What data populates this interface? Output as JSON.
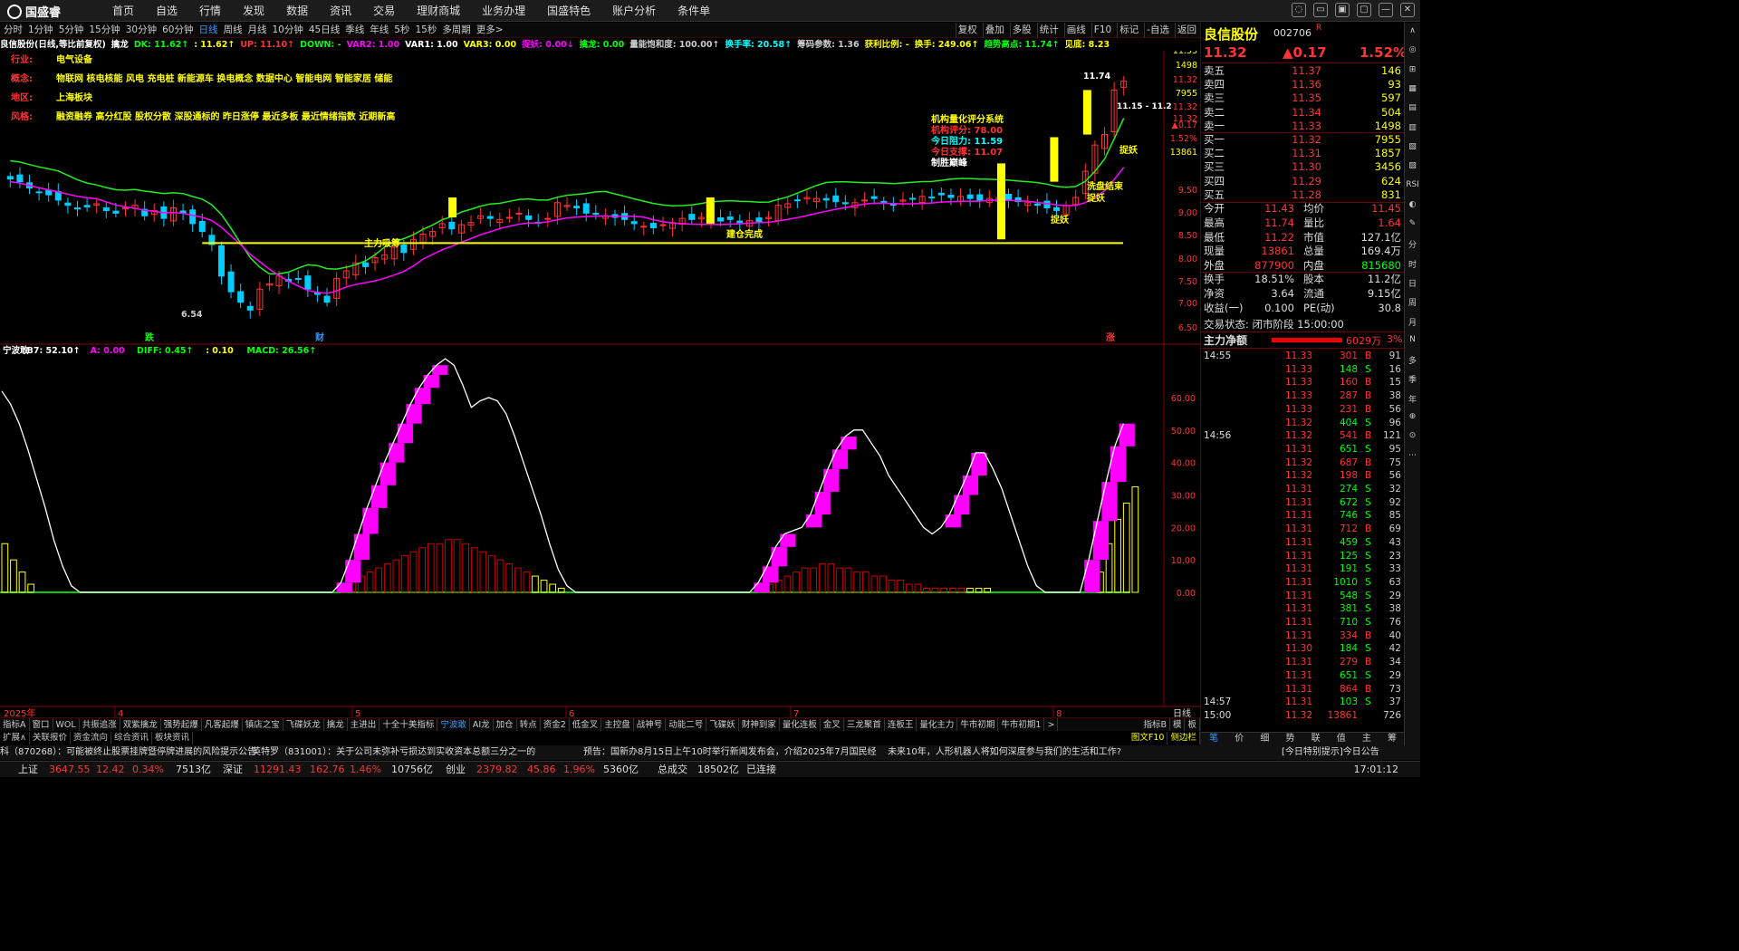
{
  "brand": {
    "name": "国盛睿"
  },
  "menu": [
    "首页",
    "自选",
    "行情",
    "发现",
    "数据",
    "资讯",
    "交易",
    "理财商城",
    "业务办理",
    "国盛特色",
    "账户分析",
    "条件单"
  ],
  "window_buttons": [
    "◌",
    "▭",
    "▣",
    "▢",
    "—",
    "✕"
  ],
  "periods": [
    "分时",
    "1分钟",
    "5分钟",
    "15分钟",
    "30分钟",
    "60分钟",
    "日线",
    "周线",
    "月线",
    "10分钟",
    "45日线",
    "季线",
    "年线",
    "5秒",
    "15秒",
    "多周期",
    "更多>"
  ],
  "active_period": "日线",
  "tools_right": [
    "复权",
    "叠加",
    "多股",
    "统计",
    "画线",
    "F10",
    "标记",
    "-自选",
    "返回"
  ],
  "indicator_line": [
    {
      "t": "良信股份(日线,等比前复权)",
      "c": "#fff"
    },
    {
      "t": "擒龙",
      "c": "#fff"
    },
    {
      "t": "DK: 11.62↑",
      "c": "#0f0"
    },
    {
      "t": ": 11.62↑",
      "c": "#ff0"
    },
    {
      "t": "UP: 11.10↑",
      "c": "#f33"
    },
    {
      "t": "DOWN: -",
      "c": "#0f0"
    },
    {
      "t": "VAR2: 1.00",
      "c": "#f0f"
    },
    {
      "t": "VAR1: 1.00",
      "c": "#fff"
    },
    {
      "t": "VAR3: 0.00",
      "c": "#ff0"
    },
    {
      "t": "捉妖: 0.00↓",
      "c": "#f0f"
    },
    {
      "t": "擒龙: 0.00",
      "c": "#0f0"
    },
    {
      "t": "量能饱和度: 100.00↑",
      "c": "#ccc"
    },
    {
      "t": "换手率: 20.58↑",
      "c": "#0ff"
    },
    {
      "t": "筹码参数: 1.36",
      "c": "#ccc"
    },
    {
      "t": "获利比例: -",
      "c": "#ff0"
    },
    {
      "t": "换手: 249.06↑",
      "c": "#ff0"
    },
    {
      "t": "趋势高点: 11.74↑",
      "c": "#0f0"
    },
    {
      "t": "见底: 8.23",
      "c": "#ff0"
    }
  ],
  "info": [
    {
      "k": "行业:",
      "v": "电气设备"
    },
    {
      "k": "概念:",
      "v": "物联网 核电核能 风电 充电桩 新能源车 换电概念 数据中心 智能电网 智能家居 储能"
    },
    {
      "k": "地区:",
      "v": "上海板块"
    },
    {
      "k": "风格:",
      "v": "融资融券 高分红股 股权分散 深股通标的 昨日涨停 最近多板 最近情绪指数 近期新高"
    }
  ],
  "quant": {
    "title": "机构量化评分系统",
    "score_label": "机构评分:",
    "score": "78.00",
    "res_label": "今日阻力:",
    "res": "11.59",
    "sup_label": "今日支撑:",
    "sup": "11.07",
    "tag": "制胜巅峰"
  },
  "annotations": {
    "zlxc": "主力吸筹",
    "jcwc": "建仓完成",
    "xpjs": "洗盘结束",
    "zy": "捉妖",
    "low": "6.54",
    "high": "11.74",
    "range": "11.15 - 11.2",
    "die": "跌",
    "cai": "财",
    "zhang": "涨"
  },
  "price_axis": [
    "11.33",
    "1498",
    "11.32",
    "7955",
    "11.32",
    "11.32",
    "▲0.17",
    "1.52%",
    "13861",
    "9.50",
    "9.00",
    "8.50",
    "8.00",
    "7.50",
    "7.00",
    "6.50"
  ],
  "macd_line": [
    {
      "t": "宁波敢",
      "c": "#fff"
    },
    {
      "t": "B7: 52.10↑",
      "c": "#fff"
    },
    {
      "t": "A: 0.00",
      "c": "#f0f"
    },
    {
      "t": "DIFF: 0.45↑",
      "c": "#0f0"
    },
    {
      "t": ": 0.10",
      "c": "#ff0"
    },
    {
      "t": "MACD: 26.56↑",
      "c": "#0f0"
    }
  ],
  "sub_axis": [
    "60.00",
    "50.00",
    "40.00",
    "30.00",
    "20.00",
    "10.00",
    "0.00"
  ],
  "dates": [
    "2025年",
    "4",
    "5",
    "6",
    "7",
    "8"
  ],
  "day_label": "日线",
  "bottom_tabs": [
    "指标A",
    "窗口",
    "WOL",
    "共振追涨",
    "双紫擒龙",
    "强势起爆",
    "凡客起爆",
    "镇店之宝",
    "飞碟妖龙",
    "擒龙",
    "主进出",
    "十全十美指标",
    "宁波敢",
    "AI龙",
    "加仓",
    "转点",
    "资金2",
    "低金叉",
    "主控盘",
    "战神号",
    "动能二号",
    "飞碟妖",
    "财神到家",
    "量化连板",
    "金叉",
    "三龙聚首",
    "连板王",
    "量化主力",
    "牛市初期",
    "牛市初期1",
    ">"
  ],
  "active_tab": "宁波敢",
  "bottom_tabs_right": [
    "指标B",
    "模",
    "板"
  ],
  "tabs2": [
    "扩展∧",
    "关联报价",
    "资金流向",
    "综合资讯",
    "板块资讯"
  ],
  "tabs2_right": [
    "图文F10",
    "侧边栏"
  ],
  "news": [
    "科（870268）：可能被终止股票挂牌暨停牌进展的风险提示公告",
    "英特罗（831001）：关于公司未弥补亏损达到实收资本总额三分之一的",
    "预告：国新办8月15日上午10时举行新闻发布会，介绍2025年7月国民经",
    "未来10年，人形机器人将如何深度参与我们的生活和工作?",
    "[今日特别提示]今日公告"
  ],
  "status": [
    {
      "t": "上证",
      "c": "#ddd"
    },
    {
      "t": "3647.55",
      "c": "#f33"
    },
    {
      "t": "12.42",
      "c": "#f33"
    },
    {
      "t": "0.34%",
      "c": "#f33"
    },
    {
      "t": "7513亿",
      "c": "#ddd"
    },
    {
      "t": "深证",
      "c": "#ddd"
    },
    {
      "t": "11291.43",
      "c": "#f33"
    },
    {
      "t": "162.76",
      "c": "#f33"
    },
    {
      "t": "1.46%",
      "c": "#f33"
    },
    {
      "t": "10756亿",
      "c": "#ddd"
    },
    {
      "t": "创业",
      "c": "#ddd"
    },
    {
      "t": "2379.82",
      "c": "#f33"
    },
    {
      "t": "45.86",
      "c": "#f33"
    },
    {
      "t": "1.96%",
      "c": "#f33"
    },
    {
      "t": "5360亿",
      "c": "#ddd"
    },
    {
      "t": "总成交",
      "c": "#ddd"
    },
    {
      "t": "18502亿",
      "c": "#ddd"
    },
    {
      "t": "已连接",
      "c": "#ddd"
    }
  ],
  "clock": "17:01:12",
  "quote": {
    "name": "良信股份",
    "code": "002706",
    "mark": "R",
    "price": "11.32",
    "chg": "▲0.17",
    "pct": "1.52%"
  },
  "asks": [
    {
      "l": "卖五",
      "p": "11.37",
      "v": "146"
    },
    {
      "l": "卖四",
      "p": "11.36",
      "v": "93"
    },
    {
      "l": "卖三",
      "p": "11.35",
      "v": "597"
    },
    {
      "l": "卖二",
      "p": "11.34",
      "v": "504"
    },
    {
      "l": "卖一",
      "p": "11.33",
      "v": "1498"
    }
  ],
  "bids": [
    {
      "l": "买一",
      "p": "11.32",
      "v": "7955"
    },
    {
      "l": "买二",
      "p": "11.31",
      "v": "1857"
    },
    {
      "l": "买三",
      "p": "11.30",
      "v": "3456"
    },
    {
      "l": "买四",
      "p": "11.29",
      "v": "624"
    },
    {
      "l": "买五",
      "p": "11.28",
      "v": "831"
    }
  ],
  "stats": [
    {
      "a": "今开",
      "b": "11.43",
      "bc": "#f33",
      "c": "均价",
      "d": "11.45",
      "dc": "#f33"
    },
    {
      "a": "最高",
      "b": "11.74",
      "bc": "#f33",
      "c": "量比",
      "d": "1.64",
      "dc": "#f33"
    },
    {
      "a": "最低",
      "b": "11.22",
      "bc": "#f33",
      "c": "市值",
      "d": "127.1亿",
      "dc": "#ddd"
    },
    {
      "a": "现量",
      "b": "13861",
      "bc": "#f33",
      "c": "总量",
      "d": "169.4万",
      "dc": "#ddd"
    },
    {
      "a": "外盘",
      "b": "877900",
      "bc": "#f33",
      "c": "内盘",
      "d": "815680",
      "dc": "#0f0"
    },
    {
      "a": "换手",
      "b": "18.51%",
      "bc": "#ddd",
      "c": "股本",
      "d": "11.2亿",
      "dc": "#ddd"
    },
    {
      "a": "净资",
      "b": "3.64",
      "bc": "#ddd",
      "c": "流通",
      "d": "9.15亿",
      "dc": "#ddd"
    },
    {
      "a": "收益(一)",
      "b": "0.100",
      "bc": "#ddd",
      "c": "PE(动)",
      "d": "30.8",
      "dc": "#ddd"
    }
  ],
  "trade_state": "交易状态: 闭市阶段 15:00:00",
  "net_label": "主力净额",
  "net_val": "6029万",
  "net_pct": "3%",
  "ticks": [
    {
      "t": "14:55",
      "p": "11.33",
      "v": "301",
      "s": "B",
      "n": "91"
    },
    {
      "t": "",
      "p": "11.33",
      "v": "148",
      "s": "S",
      "n": "16"
    },
    {
      "t": "",
      "p": "11.33",
      "v": "160",
      "s": "B",
      "n": "15"
    },
    {
      "t": "",
      "p": "11.33",
      "v": "287",
      "s": "B",
      "n": "38"
    },
    {
      "t": "",
      "p": "11.33",
      "v": "231",
      "s": "B",
      "n": "56"
    },
    {
      "t": "",
      "p": "11.32",
      "v": "404",
      "s": "S",
      "n": "96"
    },
    {
      "t": "14:56",
      "p": "11.32",
      "v": "541",
      "s": "B",
      "n": "121"
    },
    {
      "t": "",
      "p": "11.31",
      "v": "651",
      "s": "S",
      "n": "95"
    },
    {
      "t": "",
      "p": "11.32",
      "v": "687",
      "s": "B",
      "n": "75"
    },
    {
      "t": "",
      "p": "11.32",
      "v": "198",
      "s": "B",
      "n": "56"
    },
    {
      "t": "",
      "p": "11.31",
      "v": "274",
      "s": "S",
      "n": "32"
    },
    {
      "t": "",
      "p": "11.31",
      "v": "672",
      "s": "S",
      "n": "92"
    },
    {
      "t": "",
      "p": "11.31",
      "v": "746",
      "s": "S",
      "n": "85"
    },
    {
      "t": "",
      "p": "11.31",
      "v": "712",
      "s": "B",
      "n": "69"
    },
    {
      "t": "",
      "p": "11.31",
      "v": "459",
      "s": "S",
      "n": "43"
    },
    {
      "t": "",
      "p": "11.31",
      "v": "125",
      "s": "S",
      "n": "23"
    },
    {
      "t": "",
      "p": "11.31",
      "v": "191",
      "s": "S",
      "n": "33"
    },
    {
      "t": "",
      "p": "11.31",
      "v": "1010",
      "s": "S",
      "n": "63"
    },
    {
      "t": "",
      "p": "11.31",
      "v": "548",
      "s": "S",
      "n": "29"
    },
    {
      "t": "",
      "p": "11.31",
      "v": "381",
      "s": "S",
      "n": "38"
    },
    {
      "t": "",
      "p": "11.31",
      "v": "710",
      "s": "S",
      "n": "76"
    },
    {
      "t": "",
      "p": "11.31",
      "v": "334",
      "s": "B",
      "n": "40"
    },
    {
      "t": "",
      "p": "11.30",
      "v": "184",
      "s": "S",
      "n": "42"
    },
    {
      "t": "",
      "p": "11.31",
      "v": "279",
      "s": "B",
      "n": "34"
    },
    {
      "t": "",
      "p": "11.31",
      "v": "651",
      "s": "S",
      "n": "29"
    },
    {
      "t": "",
      "p": "11.31",
      "v": "864",
      "s": "B",
      "n": "73"
    },
    {
      "t": "14:57",
      "p": "11.31",
      "v": "103",
      "s": "S",
      "n": "37"
    },
    {
      "t": "15:00",
      "p": "11.32",
      "v": "13861",
      "s": "",
      "n": "726"
    }
  ],
  "rp_tabs": [
    "笔",
    "价",
    "细",
    "势",
    "联",
    "值",
    "主",
    "筹"
  ],
  "sidebar": [
    "∧",
    "◎",
    "⊞",
    "▦",
    "▤",
    "▥",
    "▧",
    "▨",
    "RSI",
    "◐",
    "✎",
    "分",
    "时",
    "日",
    "周",
    "月",
    "N",
    "多",
    "季",
    "年",
    "⊕",
    "⊙",
    "⋯"
  ],
  "colors": {
    "up": "#f33",
    "down": "#0f0",
    "accent": "#39f",
    "bg": "#000",
    "gold": "#ff0",
    "mag": "#f0f"
  },
  "chart_data": {
    "type": "candlestick",
    "title": "良信股份(日线,等比前复权)",
    "price_ylim": [
      6.3,
      11.9
    ],
    "close": [
      9.45,
      9.4,
      9.28,
      9.2,
      9.15,
      9.05,
      8.95,
      8.88,
      8.92,
      8.98,
      8.85,
      8.8,
      8.9,
      8.95,
      8.75,
      8.85,
      8.7,
      8.9,
      8.8,
      8.6,
      8.45,
      8.2,
      7.6,
      7.3,
      7.1,
      6.95,
      7.35,
      7.45,
      7.6,
      7.5,
      7.55,
      7.35,
      7.25,
      7.1,
      7.55,
      7.7,
      7.85,
      7.78,
      7.95,
      8.0,
      8.15,
      8.05,
      8.3,
      8.4,
      8.45,
      8.6,
      8.5,
      8.58,
      8.62,
      8.75,
      8.7,
      8.68,
      8.72,
      8.8,
      8.68,
      8.62,
      8.7,
      9.0,
      8.95,
      8.9,
      8.8,
      8.78,
      8.75,
      8.72,
      8.68,
      8.6,
      8.55,
      8.52,
      8.58,
      8.62,
      8.7,
      8.68,
      8.72,
      8.7,
      8.65,
      8.68,
      8.62,
      8.66,
      8.64,
      8.72,
      8.95,
      8.98,
      9.05,
      9.1,
      9.08,
      9.05,
      9.02,
      8.98,
      9.0,
      9.05,
      9.08,
      9.02,
      8.96,
      9.05,
      9.08,
      9.12,
      9.1,
      9.15,
      9.1,
      9.12,
      9.08,
      9.05,
      9.08,
      9.1,
      9.05,
      9.02,
      9.0,
      8.95,
      8.9,
      8.85,
      8.95,
      9.1,
      9.6,
      10.1,
      10.3,
      11.15,
      11.32
    ],
    "ma_short_ylabel": "",
    "support_line": 8.23,
    "low_mark": 6.54,
    "high_mark": 11.74,
    "sub_ylim": [
      0,
      72
    ],
    "sub_line": [
      62,
      58,
      52,
      44,
      35,
      26,
      16,
      8,
      2,
      0,
      0,
      0,
      0,
      0,
      0,
      0,
      0,
      0,
      0,
      0,
      0,
      0,
      0,
      0,
      0,
      0,
      0,
      0,
      0,
      0,
      0,
      0,
      0,
      0,
      0,
      0,
      0,
      0,
      0,
      3,
      10,
      18,
      26,
      33,
      40,
      46,
      52,
      58,
      63,
      67,
      70,
      72,
      70,
      64,
      57,
      59,
      60,
      59,
      55,
      48,
      40,
      32,
      24,
      15,
      7,
      2,
      0,
      0,
      0,
      0,
      0,
      0,
      0,
      0,
      0,
      0,
      0,
      0,
      0,
      0,
      0,
      0,
      0,
      0,
      0,
      0,
      0,
      3,
      8,
      14,
      18,
      19,
      20,
      24,
      31,
      38,
      44,
      48,
      50,
      50,
      46,
      42,
      36,
      32,
      28,
      24,
      20,
      18,
      20,
      24,
      30,
      36,
      43,
      43,
      38,
      32,
      24,
      16,
      8,
      2,
      0,
      0,
      0,
      0,
      0,
      10,
      22,
      34,
      45,
      52
    ],
    "sub_bars": [
      12,
      8,
      5,
      2,
      0,
      0,
      0,
      0,
      0,
      0,
      0,
      0,
      0,
      0,
      0,
      0,
      0,
      0,
      0,
      0,
      0,
      0,
      0,
      0,
      0,
      0,
      0,
      0,
      0,
      0,
      0,
      0,
      0,
      0,
      0,
      0,
      0,
      0,
      0,
      2,
      3,
      4,
      5,
      6,
      7,
      8,
      9,
      10,
      11,
      12,
      12,
      13,
      13,
      12,
      11,
      10,
      9,
      8,
      7,
      6,
      5,
      4,
      3,
      2,
      1,
      0,
      0,
      0,
      0,
      0,
      0,
      0,
      0,
      0,
      0,
      0,
      0,
      0,
      0,
      0,
      0,
      0,
      0,
      0,
      0,
      0,
      0,
      1,
      2,
      3,
      4,
      5,
      6,
      6,
      7,
      7,
      6,
      6,
      5,
      5,
      4,
      4,
      3,
      3,
      2,
      2,
      1,
      1,
      1,
      1,
      1,
      1,
      1,
      1,
      0,
      0,
      0,
      0,
      0,
      0,
      0,
      0,
      0,
      0,
      0,
      0,
      5,
      12,
      18,
      22,
      26
    ]
  }
}
